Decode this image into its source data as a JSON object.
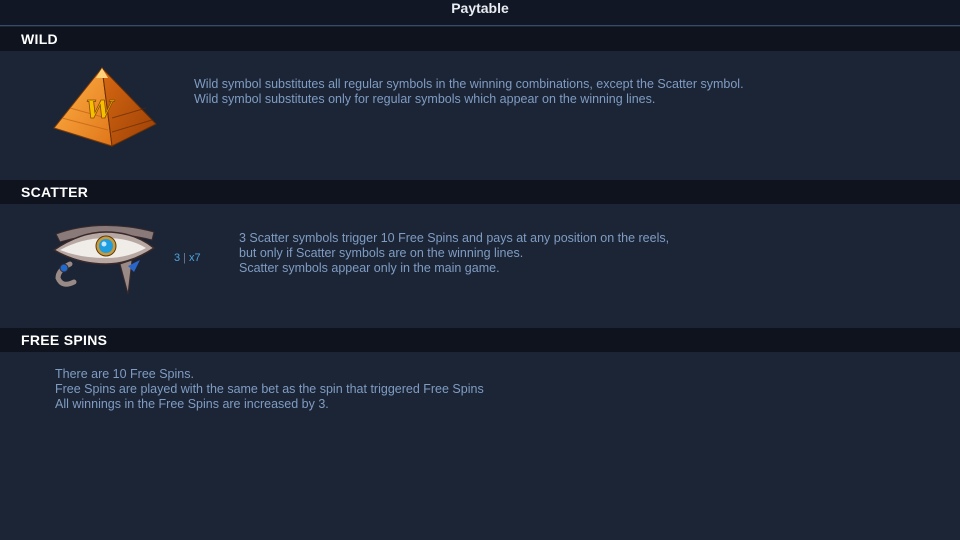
{
  "header": {
    "title": "Paytable"
  },
  "sections": {
    "wild": {
      "title": "WILD",
      "icon": "pyramid-wild-icon",
      "icon_letter": "W",
      "lines": [
        "Wild symbol substitutes all regular symbols in the winning combinations, except the Scatter symbol.",
        "Wild symbol substitutes only for regular symbols which appear on the winning lines."
      ]
    },
    "scatter": {
      "title": "SCATTER",
      "icon": "eye-of-horus-icon",
      "payout": {
        "count": "3",
        "multiplier": "x7"
      },
      "lines": [
        "3 Scatter symbols trigger 10 Free Spins and pays at any position on the reels,",
        "but only if Scatter symbols are on the winning lines.",
        "Scatter symbols appear only in the main game."
      ]
    },
    "free_spins": {
      "title": "FREE SPINS",
      "lines": [
        "There are 10 Free Spins.",
        "Free Spins are played with the same bet as the spin that triggered Free Spins",
        "All winnings in the Free Spins are increased by 3."
      ]
    }
  },
  "colors": {
    "background": "#1c2536",
    "header_band": "#0e131d",
    "text": "#7f9cc2",
    "accent": "#4da3e0"
  }
}
